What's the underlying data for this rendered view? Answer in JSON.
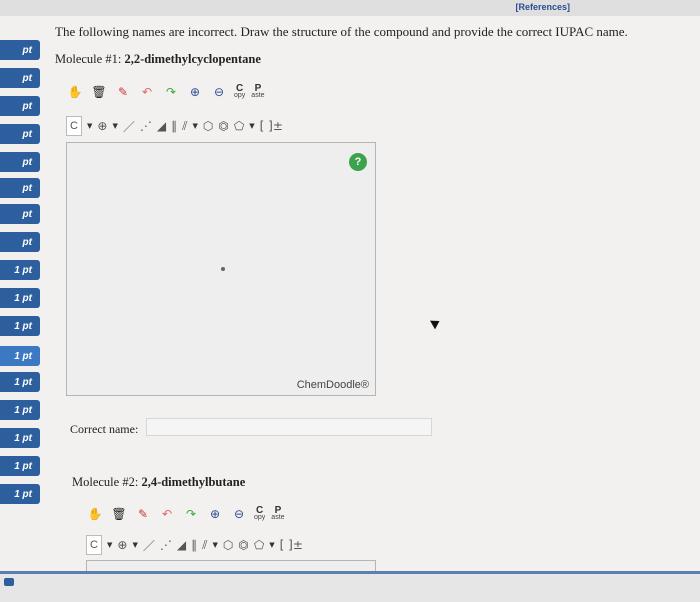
{
  "header": {
    "references_link": "[References]"
  },
  "sidebar": {
    "pt_tabs": [
      "pt",
      "pt",
      "pt",
      "pt",
      "pt",
      "pt",
      "pt",
      "pt",
      "1 pt",
      "1 pt",
      "1 pt",
      "1 pt",
      "1 pt",
      "1 pt",
      "1 pt",
      "1 pt",
      "1 pt"
    ]
  },
  "question": {
    "instructions": "The following names are incorrect. Draw the structure of the compound and provide the correct IUPAC name."
  },
  "molecule1": {
    "prefix": "Molecule #1:",
    "name": "2,2-dimethylcyclopentane",
    "answer_label": "Correct name:",
    "answer_value": ""
  },
  "molecule2": {
    "prefix": "Molecule #2:",
    "name": "2,4-dimethylbutane"
  },
  "toolbar": {
    "copy_top": "C",
    "copy_bottom": "opy",
    "paste_top": "P",
    "paste_bottom": "aste",
    "atom": "C",
    "charge": "[ ]±"
  },
  "editor": {
    "brand": "ChemDoodle®",
    "help": "?"
  },
  "colors": {
    "tab_blue": "#2d5f9e",
    "help_green": "#3ca24b",
    "link_blue": "#2a4d8f"
  }
}
